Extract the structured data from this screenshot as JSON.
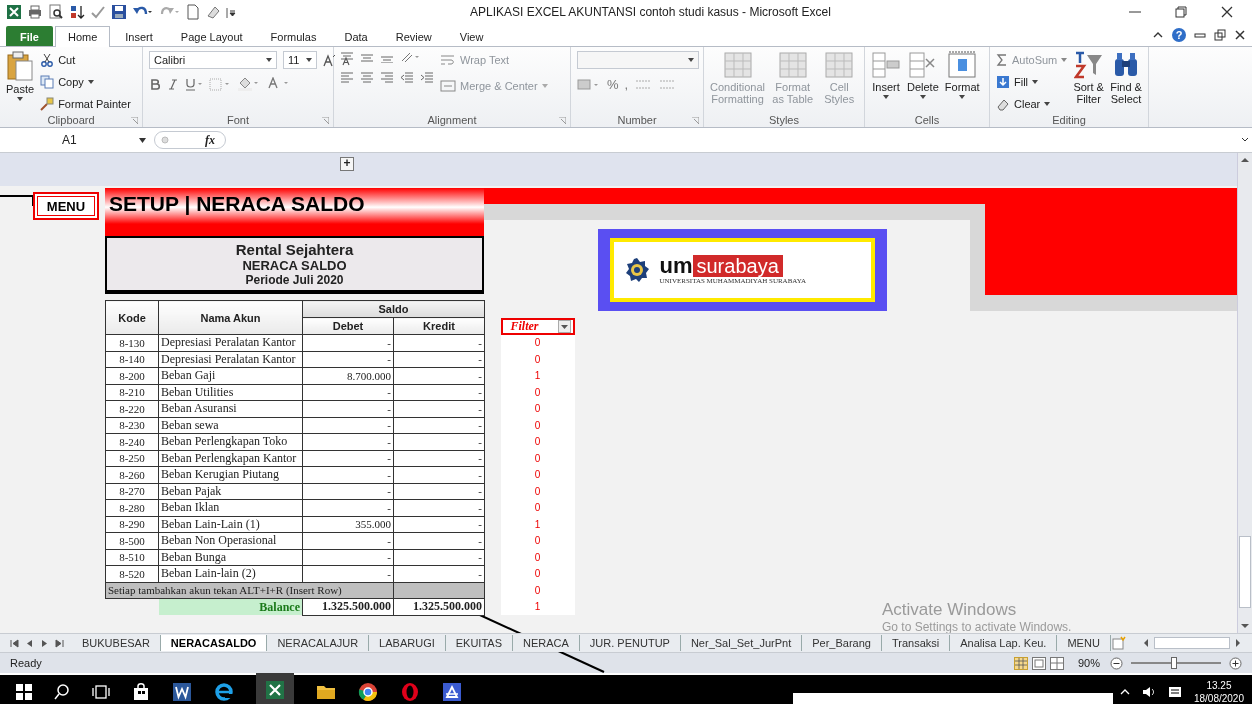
{
  "window": {
    "title": "APLIKASI EXCEL AKUNTANSI contoh studi kasus  -  Microsoft Excel",
    "help": "?"
  },
  "ribbon_tabs": [
    {
      "label": "File",
      "kind": "file",
      "selected": false
    },
    {
      "label": "Home",
      "kind": "tab",
      "selected": true
    },
    {
      "label": "Insert",
      "kind": "tab",
      "selected": false
    },
    {
      "label": "Page Layout",
      "kind": "tab",
      "selected": false
    },
    {
      "label": "Formulas",
      "kind": "tab",
      "selected": false
    },
    {
      "label": "Data",
      "kind": "tab",
      "selected": false
    },
    {
      "label": "Review",
      "kind": "tab",
      "selected": false
    },
    {
      "label": "View",
      "kind": "tab",
      "selected": false
    }
  ],
  "clipboard": {
    "label": "Clipboard",
    "paste": "Paste",
    "cut": "Cut",
    "copy": "Copy",
    "format_painter": "Format Painter"
  },
  "font": {
    "label": "Font",
    "family": "Calibri",
    "size": "11"
  },
  "alignment": {
    "label": "Alignment",
    "wrap": {
      "label": "Wrap Text",
      "disabled": true
    },
    "merge": {
      "label": "Merge & Center",
      "disabled": true
    }
  },
  "number": {
    "label": "Number",
    "percent": "%",
    "comma": ","
  },
  "styles": {
    "label": "Styles",
    "buttons": [
      {
        "label": "Conditional Formatting",
        "disabled": true
      },
      {
        "label": "Format as Table",
        "disabled": true
      },
      {
        "label": "Cell Styles",
        "disabled": true
      }
    ]
  },
  "cells": {
    "label": "Cells",
    "buttons": [
      {
        "label": "Insert",
        "disabled": false
      },
      {
        "label": "Delete",
        "disabled": false
      },
      {
        "label": "Format",
        "disabled": false
      }
    ]
  },
  "editing": {
    "label": "Editing",
    "autosum": {
      "label": "AutoSum",
      "disabled": true
    },
    "fill": "Fill",
    "clear": "Clear",
    "sort": "Sort & Filter",
    "find": "Find & Select"
  },
  "formula_bar": {
    "name_box": "A1",
    "function_label": "fx"
  },
  "sheet": {
    "expand": "+",
    "menu_button": "MENU",
    "banner": "SETUP | NERACA SALDO",
    "company": "Rental Sejahtera",
    "report": "NERACA SALDO",
    "period": "Periode Juli 2020",
    "columns": {
      "kode": "Kode",
      "nama": "Nama Akun",
      "saldo": "Saldo",
      "debet": "Debet",
      "kredit": "Kredit",
      "filter": "Filter"
    },
    "rows": [
      {
        "kode": "8-130",
        "nama": "Depresiasi Peralatan Kantor",
        "debet": "-",
        "kredit": "-",
        "filter": "0"
      },
      {
        "kode": "8-140",
        "nama": "Depresiasi Peralatan Kantor",
        "debet": "-",
        "kredit": "-",
        "filter": "0"
      },
      {
        "kode": "8-200",
        "nama": "Beban Gaji",
        "debet": "8.700.000",
        "kredit": "-",
        "filter": "1"
      },
      {
        "kode": "8-210",
        "nama": "Beban Utilities",
        "debet": "-",
        "kredit": "-",
        "filter": "0"
      },
      {
        "kode": "8-220",
        "nama": "Beban Asuransi",
        "debet": "-",
        "kredit": "-",
        "filter": "0"
      },
      {
        "kode": "8-230",
        "nama": "Beban sewa",
        "debet": "-",
        "kredit": "-",
        "filter": "0"
      },
      {
        "kode": "8-240",
        "nama": "Beban Perlengkapan Toko",
        "debet": "-",
        "kredit": "-",
        "filter": "0"
      },
      {
        "kode": "8-250",
        "nama": "Beban Perlengkapan Kantor",
        "debet": "-",
        "kredit": "-",
        "filter": "0"
      },
      {
        "kode": "8-260",
        "nama": "Beban Kerugian Piutang",
        "debet": "-",
        "kredit": "-",
        "filter": "0"
      },
      {
        "kode": "8-270",
        "nama": "Beban Pajak",
        "debet": "-",
        "kredit": "-",
        "filter": "0"
      },
      {
        "kode": "8-280",
        "nama": "Beban Iklan",
        "debet": "-",
        "kredit": "-",
        "filter": "0"
      },
      {
        "kode": "8-290",
        "nama": "Beban Lain-Lain (1)",
        "debet": "355.000",
        "kredit": "-",
        "filter": "1"
      },
      {
        "kode": "8-500",
        "nama": "Beban Non Operasional",
        "debet": "-",
        "kredit": "-",
        "filter": "0"
      },
      {
        "kode": "8-510",
        "nama": "Beban Bunga",
        "debet": "-",
        "kredit": "-",
        "filter": "0"
      },
      {
        "kode": "8-520",
        "nama": "Beban Lain-lain (2)",
        "debet": "-",
        "kredit": "-",
        "filter": "0"
      }
    ],
    "note": "Setiap tambahkan akun tekan ALT+I+R (Insert Row)",
    "note_filter": "0",
    "balance_label": "Balance",
    "balance_debet": "1.325.500.000",
    "balance_kredit": "1.325.500.000",
    "balance_filter": "1",
    "logo": {
      "brand_um": "um",
      "brand_surabaya": "surabaya",
      "subtitle": "UNIVERSITAS MUHAMMADIYAH SURABAYA"
    }
  },
  "activation": {
    "title": "Activate Windows",
    "text": "Go to Settings to activate Windows."
  },
  "sheet_tabs": [
    {
      "label": "BUKUBESAR",
      "selected": false
    },
    {
      "label": "NERACASALDO",
      "selected": true
    },
    {
      "label": "NERACALAJUR",
      "selected": false
    },
    {
      "label": "LABARUGI",
      "selected": false
    },
    {
      "label": "EKUITAS",
      "selected": false
    },
    {
      "label": "NERACA",
      "selected": false
    },
    {
      "label": "JUR. PENUTUP",
      "selected": false
    },
    {
      "label": "Ner_Sal_Set_JurPnt",
      "selected": false
    },
    {
      "label": "Per_Barang",
      "selected": false
    },
    {
      "label": "Transaksi",
      "selected": false
    },
    {
      "label": "Analisa Lap. Keu.",
      "selected": false
    },
    {
      "label": "MENU",
      "selected": false
    }
  ],
  "status_bar": {
    "status": "Ready",
    "zoom": "90%",
    "zoom_slider": {
      "level": 0.48
    }
  },
  "taskbar": {
    "time": "13.25",
    "date": "18/08/2020"
  }
}
